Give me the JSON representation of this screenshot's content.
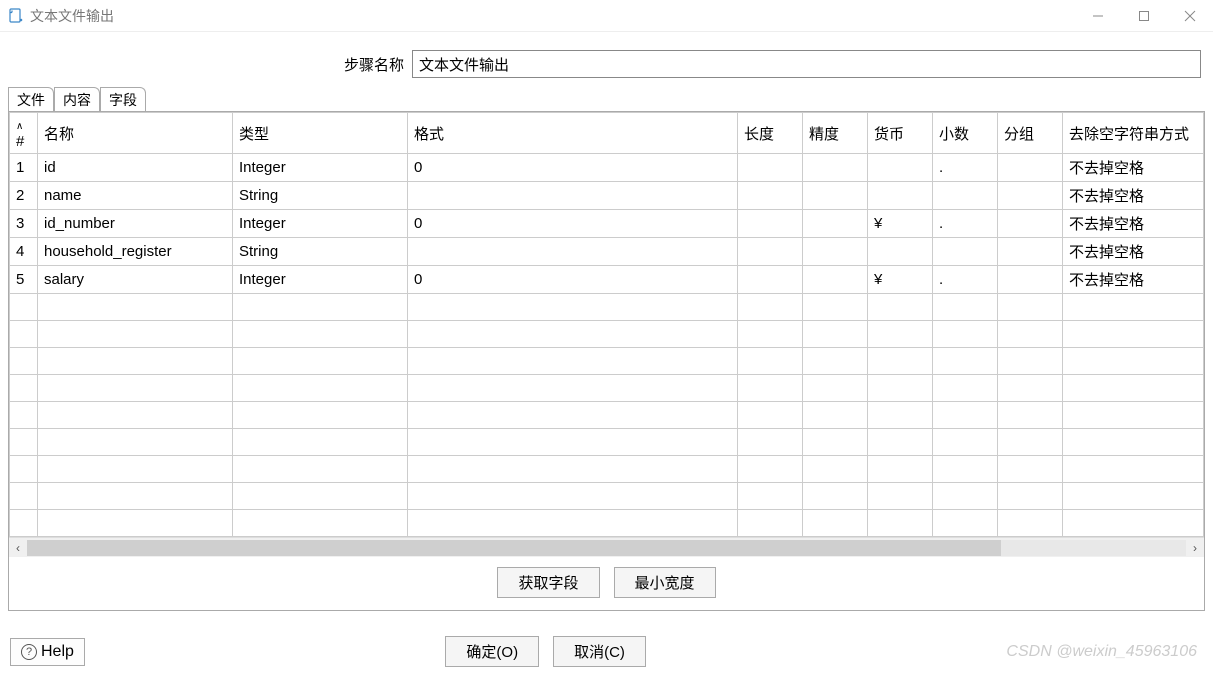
{
  "window": {
    "title": "文本文件输出"
  },
  "step": {
    "label": "步骤名称",
    "value": "文本文件输出"
  },
  "tabs": [
    {
      "label": "文件"
    },
    {
      "label": "内容"
    },
    {
      "label": "字段"
    }
  ],
  "table": {
    "headers": {
      "num": "#",
      "name": "名称",
      "type": "类型",
      "format": "格式",
      "length": "长度",
      "precision": "精度",
      "currency": "货币",
      "decimal": "小数",
      "group": "分组",
      "trim": "去除空字符串方式"
    },
    "rows": [
      {
        "num": "1",
        "name": "id",
        "type": "Integer",
        "format": "0",
        "length": "",
        "precision": "",
        "currency": "",
        "decimal": ".",
        "group": "",
        "trim": "不去掉空格"
      },
      {
        "num": "2",
        "name": "name",
        "type": "String",
        "format": "",
        "length": "",
        "precision": "",
        "currency": "",
        "decimal": "",
        "group": "",
        "trim": "不去掉空格"
      },
      {
        "num": "3",
        "name": "id_number",
        "type": "Integer",
        "format": "0",
        "length": "",
        "precision": "",
        "currency": "¥",
        "decimal": ".",
        "group": "",
        "trim": "不去掉空格"
      },
      {
        "num": "4",
        "name": "household_register",
        "type": "String",
        "format": "",
        "length": "",
        "precision": "",
        "currency": "",
        "decimal": "",
        "group": "",
        "trim": "不去掉空格"
      },
      {
        "num": "5",
        "name": "salary",
        "type": "Integer",
        "format": "0",
        "length": "",
        "precision": "",
        "currency": "¥",
        "decimal": ".",
        "group": "",
        "trim": "不去掉空格"
      }
    ],
    "empty_rows": 9
  },
  "buttons": {
    "get_fields": "获取字段",
    "min_width": "最小宽度",
    "ok": "确定(O)",
    "cancel": "取消(C)",
    "help": "Help"
  },
  "watermark": "CSDN @weixin_45963106"
}
